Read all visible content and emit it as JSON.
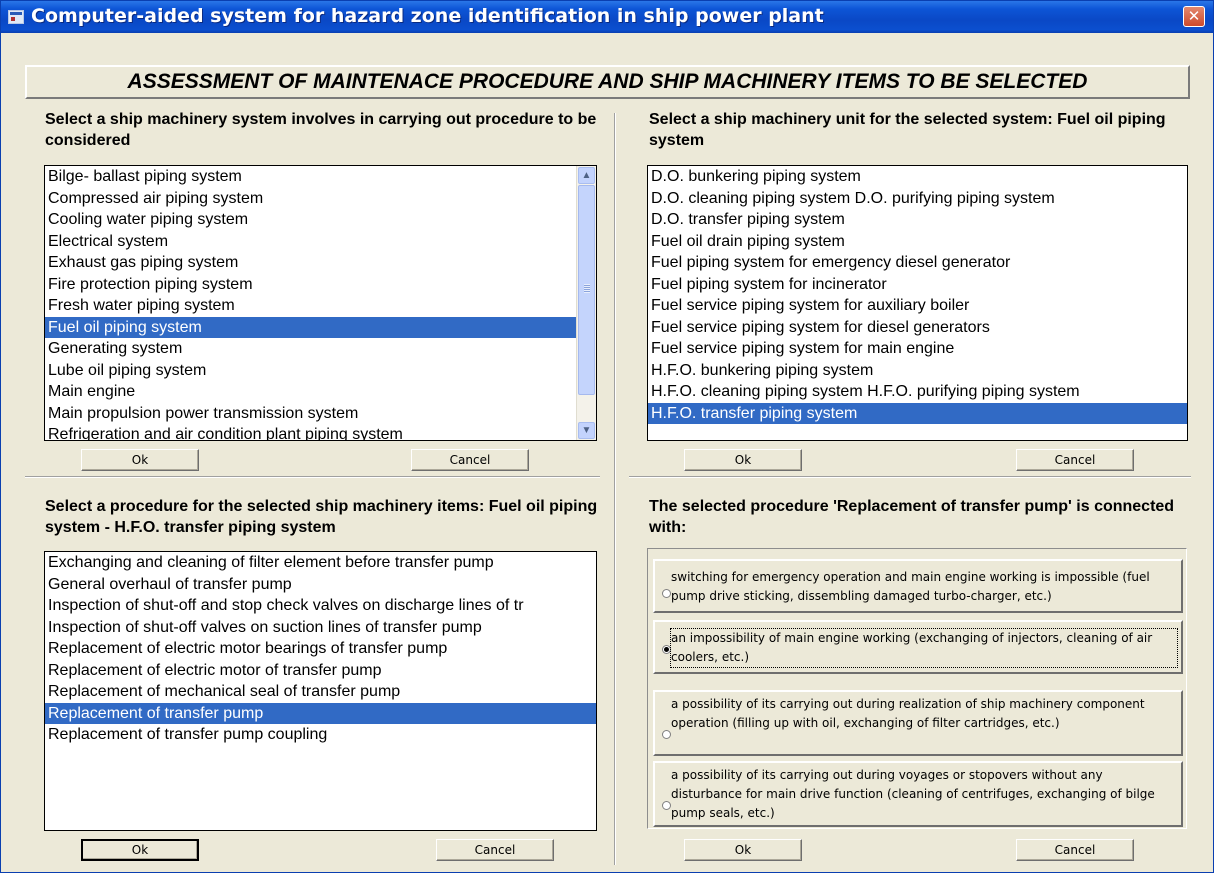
{
  "window": {
    "title": "Computer-aided system for hazard zone identification in ship power plant",
    "close_glyph": "✕"
  },
  "banner": "ASSESSMENT OF MAINTENACE PROCEDURE AND SHIP MACHINERY ITEMS TO BE SELECTED",
  "panel_system": {
    "heading": "Select a ship machinery system involves in carrying out procedure to be considered",
    "items": [
      "Bilge- ballast piping system",
      "Compressed air piping system",
      "Cooling water piping system",
      "Electrical system",
      "Exhaust gas piping system",
      "Fire protection piping system",
      "Fresh water piping system",
      "Fuel oil piping system",
      "Generating system",
      "Lube oil piping system",
      "Main engine",
      "Main propulsion power transmission system",
      "Refrigeration and air condition plant piping system"
    ],
    "selected": "Fuel oil piping system",
    "ok_label": "Ok",
    "cancel_label": "Cancel"
  },
  "panel_unit": {
    "heading": "Select a ship machinery unit for the selected system: Fuel oil piping system",
    "items": [
      "D.O. bunkering piping system",
      "D.O. cleaning piping system D.O. purifying piping system",
      "D.O. transfer piping system",
      "Fuel oil drain piping system",
      "Fuel piping system for emergency diesel generator",
      "Fuel piping system for incinerator",
      "Fuel service piping system for auxiliary boiler",
      "Fuel service piping system for diesel generators",
      "Fuel service piping system for main engine",
      "H.F.O. bunkering piping system",
      "H.F.O. cleaning piping system H.F.O. purifying piping system",
      "H.F.O. transfer piping system"
    ],
    "selected": "H.F.O. transfer piping system",
    "ok_label": "Ok",
    "cancel_label": "Cancel"
  },
  "panel_procedure": {
    "heading": "Select a procedure for the selected ship machinery items: Fuel oil piping system - H.F.O. transfer piping system",
    "items": [
      "Exchanging and cleaning of filter element before transfer pump",
      "General overhaul of transfer pump",
      "Inspection of shut-off and stop check valves on discharge lines of tr",
      "Inspection of shut-off valves on suction lines of transfer pump",
      "Replacement of electric motor bearings of transfer pump",
      "Replacement of electric motor of transfer pump",
      "Replacement of mechanical seal of transfer pump",
      "Replacement of transfer pump",
      "Replacement of transfer pump coupling"
    ],
    "selected": "Replacement of transfer pump",
    "ok_label": "Ok",
    "cancel_label": "Cancel"
  },
  "panel_connection": {
    "heading": "The selected procedure 'Replacement of transfer pump' is connected with:",
    "options": [
      "switching for emergency operation and main engine working is impossible (fuel pump drive sticking, dissembling damaged turbo-charger, etc.)",
      "an impossibility of main engine working (exchanging of injectors, cleaning of air coolers, etc.)",
      "a possibility of its carrying out during realization of ship machinery component operation (filling up with oil, exchanging of filter cartridges, etc.)",
      "a possibility of its carrying out during voyages or stopovers without any disturbance for main drive function (cleaning of centrifuges, exchanging of bilge pump seals, etc.)"
    ],
    "selected_index": 1,
    "ok_label": "Ok",
    "cancel_label": "Cancel"
  },
  "colors": {
    "titlebar": "#0b4fcf",
    "dialog_bg": "#ece9d8",
    "selection": "#316ac5",
    "close_button": "#cd4a2c"
  },
  "icons": {
    "app": "app-window-icon",
    "close": "close-icon",
    "scroll_up": "scroll-up-arrow-icon",
    "scroll_down": "scroll-down-arrow-icon"
  }
}
